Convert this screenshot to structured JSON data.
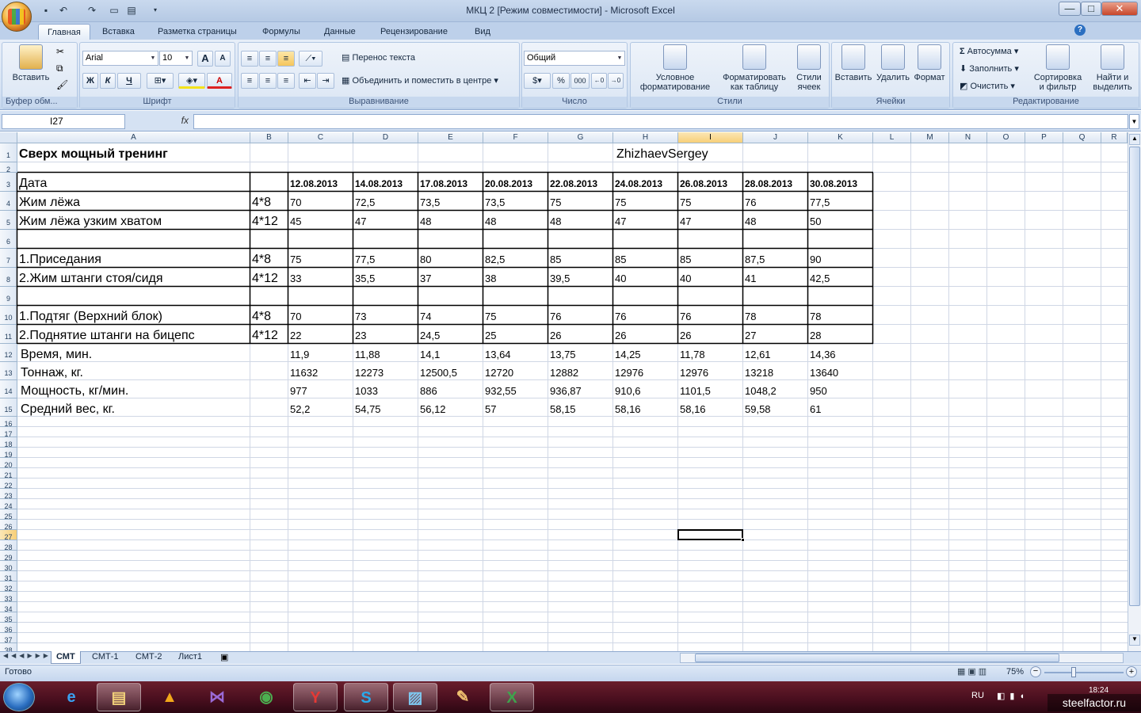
{
  "window": {
    "title": "МКЦ 2  [Режим совместимости] - Microsoft Excel",
    "buttons": {
      "minimize": "—",
      "maximize": "□",
      "close": "✕"
    }
  },
  "quick_access": [
    "save-icon",
    "undo-icon",
    "redo-icon",
    "print-preview-icon",
    "print-icon",
    "customize-icon"
  ],
  "ribbon_tabs": [
    "Главная",
    "Вставка",
    "Разметка страницы",
    "Формулы",
    "Данные",
    "Рецензирование",
    "Вид"
  ],
  "active_ribbon_tab": "Главная",
  "ribbon": {
    "clipboard": {
      "paste": "Вставить",
      "label": "Буфер обм..."
    },
    "font": {
      "name": "Arial",
      "size": "10",
      "grow": "A",
      "shrink": "A",
      "bold": "Ж",
      "italic": "К",
      "underline": "Ч",
      "font_color": "A",
      "label": "Шрифт"
    },
    "alignment": {
      "wrap": "Перенос текста",
      "merge": "Объединить и поместить в центре",
      "label": "Выравнивание"
    },
    "number": {
      "format": "Общий",
      "percent": "%",
      "thousands": "000",
      "label": "Число"
    },
    "styles": {
      "conditional": "Условное форматирование",
      "as_table": "Форматировать как таблицу",
      "cell_styles": "Стили ячеек",
      "label": "Стили"
    },
    "cells": {
      "insert": "Вставить",
      "delete": "Удалить",
      "format": "Формат",
      "label": "Ячейки"
    },
    "editing": {
      "autosum": "Автосумма",
      "fill": "Заполнить",
      "clear": "Очистить",
      "sort": "Сортировка и фильтр",
      "find": "Найти и выделить",
      "label": "Редактирование"
    }
  },
  "formula_bar": {
    "name_box": "I27",
    "fx": "fx",
    "value": ""
  },
  "columns": [
    "A",
    "B",
    "C",
    "D",
    "E",
    "F",
    "G",
    "H",
    "I",
    "J",
    "K",
    "L",
    "M",
    "N",
    "O",
    "P",
    "Q",
    "R"
  ],
  "selected_cell": {
    "col": "I",
    "row": "27"
  },
  "rows_visible": 38,
  "sheet": {
    "title": "Сверх мощный тренинг",
    "author": "ZhizhaevSergey",
    "header_label": "Дата",
    "dates": [
      "12.08.2013",
      "14.08.2013",
      "17.08.2013",
      "20.08.2013",
      "22.08.2013",
      "24.08.2013",
      "26.08.2013",
      "28.08.2013",
      "30.08.2013"
    ],
    "exercises": [
      {
        "row": 4,
        "name": "Жим лёжа",
        "scheme": "4*8",
        "values": [
          "70",
          "72,5",
          "73,5",
          "73,5",
          "75",
          "75",
          "75",
          "76",
          "77,5"
        ]
      },
      {
        "row": 5,
        "name": "Жим лёжа узким хватом",
        "scheme": "4*12",
        "values": [
          "45",
          "47",
          "48",
          "48",
          "48",
          "47",
          "47",
          "48",
          "50"
        ]
      },
      {
        "row": 7,
        "name": "1.Приседания",
        "scheme": "4*8",
        "values": [
          "75",
          "77,5",
          "80",
          "82,5",
          "85",
          "85",
          "85",
          "87,5",
          "90"
        ]
      },
      {
        "row": 8,
        "name": "2.Жим штанги стоя/сидя",
        "scheme": "4*12",
        "values": [
          "33",
          "35,5",
          "37",
          "38",
          "39,5",
          "40",
          "40",
          "41",
          "42,5"
        ]
      },
      {
        "row": 10,
        "name": "1.Подтяг (Верхний блок)",
        "scheme": "4*8",
        "values": [
          "70",
          "73",
          "74",
          "75",
          "76",
          "76",
          "76",
          "78",
          "78"
        ]
      },
      {
        "row": 11,
        "name": "2.Поднятие штанги на бицепс",
        "scheme": "4*12",
        "values": [
          "22",
          "23",
          "24,5",
          "25",
          "26",
          "26",
          "26",
          "27",
          "28"
        ]
      }
    ],
    "stats": [
      {
        "row": 12,
        "name": "Время, мин.",
        "values": [
          "11,9",
          "11,88",
          "14,1",
          "13,64",
          "13,75",
          "14,25",
          "11,78",
          "12,61",
          "14,36"
        ]
      },
      {
        "row": 13,
        "name": "Тоннаж, кг.",
        "values": [
          "11632",
          "12273",
          "12500,5",
          "12720",
          "12882",
          "12976",
          "12976",
          "13218",
          "13640"
        ]
      },
      {
        "row": 14,
        "name": "Мощность, кг/мин.",
        "values": [
          "977",
          "1033",
          "886",
          "932,55",
          "936,87",
          "910,6",
          "1101,5",
          "1048,2",
          "950"
        ]
      },
      {
        "row": 15,
        "name": "Средний вес, кг.",
        "values": [
          "52,2",
          "54,75",
          "56,12",
          "57",
          "58,15",
          "58,16",
          "58,16",
          "59,58",
          "61"
        ]
      }
    ]
  },
  "sheet_tabs": [
    "СМТ",
    "СМТ-1",
    "СМТ-2",
    "Лист1"
  ],
  "active_sheet": "СМТ",
  "status": {
    "ready": "Готово",
    "zoom": "75%"
  },
  "taskbar": {
    "apps": [
      "start-orb",
      "internet-explorer-icon",
      "file-explorer-icon",
      "aimp-icon",
      "visual-studio-icon",
      "chrome-icon",
      "yandex-browser-icon",
      "skype-icon",
      "photo-viewer-icon",
      "paint-icon",
      "excel-icon"
    ],
    "language": "RU",
    "time": "18:24",
    "watermark": "steelfactor.ru"
  },
  "colors": {
    "accent": "#2b579a",
    "selection": "#f7cf78",
    "ribbon": "#d5e2f3",
    "taskbar": "#4a0f1f"
  }
}
